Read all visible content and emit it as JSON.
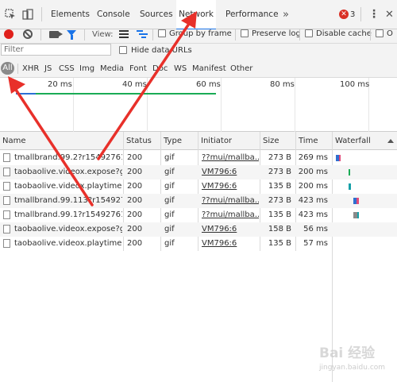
{
  "tabs": [
    {
      "label": "Elements",
      "active": false
    },
    {
      "label": "Console",
      "active": false
    },
    {
      "label": "Sources",
      "active": false
    },
    {
      "label": "Network",
      "active": true
    },
    {
      "label": "Performance",
      "active": false
    }
  ],
  "more_tabs": "»",
  "error_count": "3",
  "kebab": "⋮",
  "close": "✕",
  "toolbar": {
    "view_label": "View:",
    "group_by_frame": "Group by frame",
    "preserve_log": "Preserve log",
    "disable_cache": "Disable cache",
    "offline_initial": "O"
  },
  "filter": {
    "placeholder": "Filter",
    "hide_data_urls": "Hide data URLs"
  },
  "types": [
    "All",
    "XHR",
    "JS",
    "CSS",
    "Img",
    "Media",
    "Font",
    "Doc",
    "WS",
    "Manifest",
    "Other"
  ],
  "overview_ticks": [
    "20 ms",
    "40 ms",
    "60 ms",
    "80 ms",
    "100 ms"
  ],
  "columns": [
    "Name",
    "Status",
    "Type",
    "Initiator",
    "Size",
    "Time",
    "Waterfall"
  ],
  "rows": [
    {
      "name": "tmallbrand.99.2?r15492761...",
      "status": "200",
      "type": "gif",
      "initiator": "??mui/mallba...",
      "size": "273 B",
      "time": "269 ms"
    },
    {
      "name": "taobaolive.videox.expose?g...",
      "status": "200",
      "type": "gif",
      "initiator": "VM796:6",
      "size": "273 B",
      "time": "200 ms"
    },
    {
      "name": "taobaolive.videox.playtime?...",
      "status": "200",
      "type": "gif",
      "initiator": "VM796:6",
      "size": "135 B",
      "time": "200 ms"
    },
    {
      "name": "tmallbrand.99.113?r154927...",
      "status": "200",
      "type": "gif",
      "initiator": "??mui/mallba...",
      "size": "273 B",
      "time": "423 ms"
    },
    {
      "name": "tmallbrand.99.1?r15492761...",
      "status": "200",
      "type": "gif",
      "initiator": "??mui/mallba...",
      "size": "135 B",
      "time": "423 ms"
    },
    {
      "name": "taobaolive.videox.expose?g...",
      "status": "200",
      "type": "gif",
      "initiator": "VM796:6",
      "size": "158 B",
      "time": "56 ms"
    },
    {
      "name": "taobaolive.videox.playtime?...",
      "status": "200",
      "type": "gif",
      "initiator": "VM796:6",
      "size": "135 B",
      "time": "57 ms"
    }
  ],
  "watermark": {
    "text": "Bai 经验",
    "sub": "jingyan.baidu.com"
  },
  "colors": {
    "accent": "#1a73e8",
    "record": "#e0211c",
    "error": "#d93025",
    "arrow": "#e8302a"
  }
}
